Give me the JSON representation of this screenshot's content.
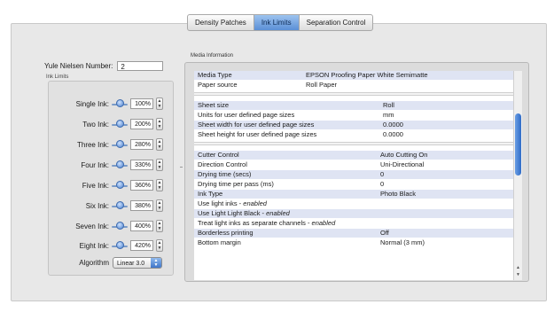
{
  "tabs": [
    {
      "label": "Density Patches",
      "active": false
    },
    {
      "label": "Ink Limits",
      "active": true
    },
    {
      "label": "Separation Control",
      "active": false
    }
  ],
  "yule": {
    "label": "Yule Nielsen Number:",
    "value": "2"
  },
  "ink_limits": {
    "title": "Ink Limits",
    "rows": [
      {
        "label": "Single Ink:",
        "value": "100%"
      },
      {
        "label": "Two Ink:",
        "value": "200%"
      },
      {
        "label": "Three Ink:",
        "value": "280%"
      },
      {
        "label": "Four Ink:",
        "value": "330%"
      },
      {
        "label": "Five Ink:",
        "value": "360%"
      },
      {
        "label": "Six Ink:",
        "value": "380%"
      },
      {
        "label": "Seven Ink:",
        "value": "400%"
      },
      {
        "label": "Eight Ink:",
        "value": "420%"
      }
    ],
    "algorithm": {
      "label": "Algorithm",
      "value": "Linear 3.0"
    }
  },
  "media": {
    "title": "Media Information",
    "groups": [
      [
        {
          "key": "Media Type",
          "value": "EPSON Proofing Paper White Semimatte"
        },
        {
          "key": "Paper source",
          "value": "Roll Paper"
        }
      ],
      [
        {
          "key": "Sheet size",
          "value": "Roll"
        },
        {
          "key": "Units for user defined page sizes",
          "value": "mm"
        },
        {
          "key": "Sheet width for user defined page sizes",
          "value": "0.0000"
        },
        {
          "key": "Sheet height for user defined page sizes",
          "value": "0.0000"
        }
      ],
      [
        {
          "key": "Cutter Control",
          "value": "Auto Cutting On"
        },
        {
          "key": "Direction Control",
          "value": "Uni-Directional"
        },
        {
          "key": "Drying time (secs)",
          "value": "0"
        },
        {
          "key": "Drying time per pass (ms)",
          "value": "0"
        },
        {
          "key": "Ink Type",
          "value": "Photo Black"
        },
        {
          "key": "Use light inks - enabled",
          "value": ""
        },
        {
          "key": "Use Light Light Black - enabled",
          "value": ""
        },
        {
          "key": "Treat light inks as separate channels - enabled",
          "value": ""
        },
        {
          "key": "Borderless printing",
          "value": "Off"
        },
        {
          "key": "Bottom margin",
          "value": "Normal (3 mm)"
        }
      ]
    ]
  },
  "icons": {
    "slider": "slider-knob-icon",
    "stepper": "stepper-arrows-icon",
    "popup": "popup-arrows-icon"
  },
  "colors": {
    "accent": "#3f76c8",
    "row_tint": "#dfe4f3",
    "window_bg": "#e8e8e8"
  }
}
